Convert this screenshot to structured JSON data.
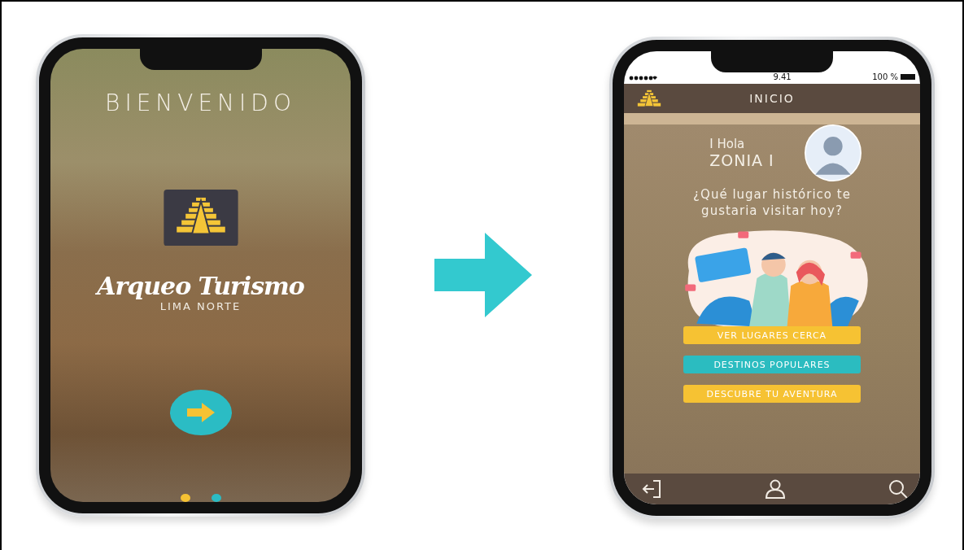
{
  "welcome_screen": {
    "title": "BIENVENIDO",
    "brand": "Arqueo Turismo",
    "brand_subtitle": "LIMA NORTE",
    "pages": [
      {
        "selected": true
      },
      {
        "selected": false
      }
    ]
  },
  "home_screen": {
    "status_bar": {
      "time": "9.41",
      "battery": "100 %"
    },
    "header": {
      "title": "INICIO"
    },
    "greeting": "I Hola",
    "user_name": "ZONIA I",
    "question": "¿Qué lugar histórico te gustaria visitar hoy?",
    "buttons": [
      {
        "label": "VER LUGARES CERCA",
        "color": "#f6c233"
      },
      {
        "label": "DESTINOS POPULARES",
        "color": "#2bbcc0"
      },
      {
        "label": "DESCUBRE TU AVENTURA",
        "color": "#f6c233"
      }
    ]
  }
}
